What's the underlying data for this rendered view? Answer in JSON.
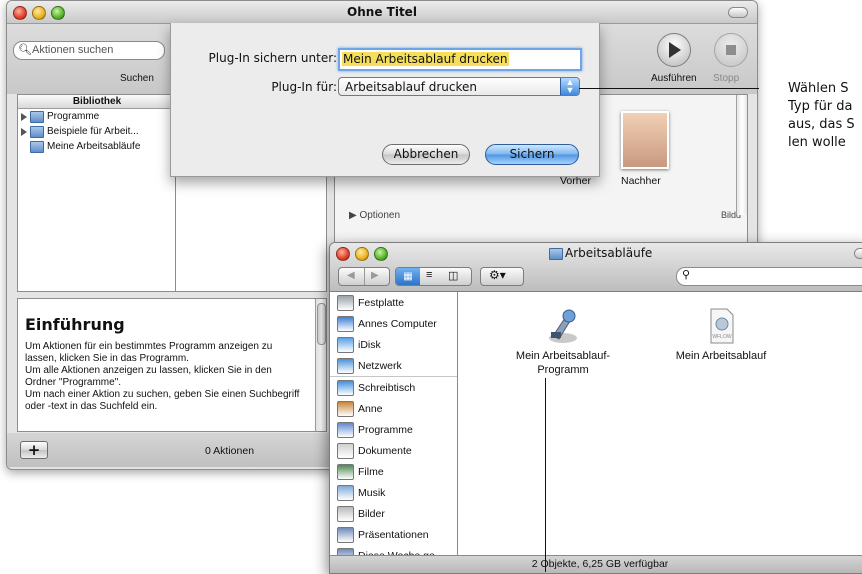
{
  "automator": {
    "title": "Ohne Titel",
    "search_placeholder": "Aktionen suchen",
    "search_label": "Suchen",
    "library_header": "Bibliothek",
    "library_items": [
      "Programme",
      "Beispiele für Arbeit...",
      "Meine Arbeitsabläufe"
    ],
    "run_label": "Ausführen",
    "stop_label": "Stopp",
    "options_label": "Optionen",
    "before_label": "Vorher",
    "after_label": "Nachher",
    "image_label": "Bildd",
    "intro_title": "Einführung",
    "intro_text": "Um Aktionen für ein bestimmtes Programm anzeigen zu lassen, klicken Sie in das Programm.\nUm alle Aktionen anzeigen zu lassen, klicken Sie in den Ordner \"Programme\".\nUm nach einer Aktion zu suchen, geben Sie einen Suchbegriff oder -text in das Suchfeld ein.",
    "add_label": "+",
    "action_count": "0 Aktionen"
  },
  "sheet": {
    "save_as_label": "Plug-In sichern unter:",
    "save_as_value": "Mein Arbeitsablauf drucken",
    "plugin_for_label": "Plug-In für:",
    "plugin_for_value": "Arbeitsablauf drucken",
    "cancel_label": "Abbrechen",
    "save_label": "Sichern"
  },
  "finder": {
    "title": "Arbeitsabläufe",
    "sidebar": [
      "Festplatte",
      "Annes Computer",
      "iDisk",
      "Netzwerk",
      "Schreibtisch",
      "Anne",
      "Programme",
      "Dokumente",
      "Filme",
      "Musik",
      "Bilder",
      "Präsentationen",
      "Diese Woche ge..."
    ],
    "files": [
      {
        "name": "Mein Arbeitsablauf-Programm",
        "line1": "Mein Arbeitsablauf-",
        "line2": "Programm",
        "icon": "automator-app-icon"
      },
      {
        "name": "Mein Arbeitsablauf",
        "line1": "Mein Arbeitsablauf",
        "line2": "",
        "icon": "workflow-document-icon"
      }
    ],
    "file_badge": "WFLOW",
    "status": "2 Objekte, 6,25 GB verfügbar"
  },
  "callout": {
    "line1": "Wählen S",
    "line2": "Typ für da",
    "line3": "aus, das S",
    "line4": "len wolle"
  }
}
